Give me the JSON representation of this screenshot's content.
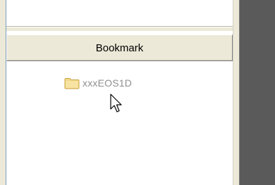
{
  "bookmark_panel": {
    "header_label": "Bookmark",
    "items": [
      {
        "label": "xxxEOS1D",
        "icon": "folder-icon"
      }
    ]
  },
  "colors": {
    "panel_background": "#ece9d8",
    "dark_pane": "#5a5a5a",
    "item_text": "#8f8f8f"
  }
}
